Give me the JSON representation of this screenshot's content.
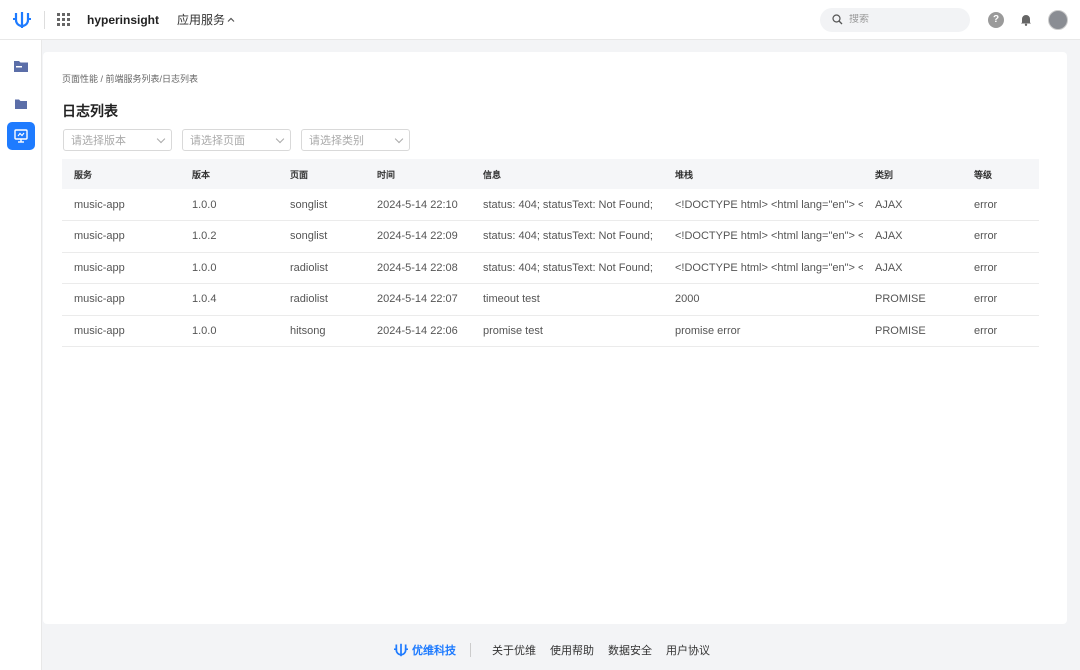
{
  "header": {
    "brand": "hyperinsight",
    "app_menu": "应用服务",
    "search_placeholder": "搜索",
    "help_symbol": "?"
  },
  "breadcrumb": "页面性能 / 前端服务列表/日志列表",
  "page_title": "日志列表",
  "filters": {
    "version": "请选择版本",
    "page": "请选择页面",
    "category": "请选择类别"
  },
  "table": {
    "columns": [
      "服务",
      "版本",
      "页面",
      "时间",
      "信息",
      "堆栈",
      "类别",
      "等级"
    ],
    "rows": [
      [
        "music-app",
        "1.0.0",
        "songlist",
        "2024-5-14 22:10",
        "status: 404; statusText: Not Found;",
        "<!DOCTYPE html> <html lang=\"en\"> <",
        "AJAX",
        "error"
      ],
      [
        "music-app",
        "1.0.2",
        "songlist",
        "2024-5-14 22:09",
        "status: 404; statusText: Not Found;",
        "<!DOCTYPE html> <html lang=\"en\"> <",
        "AJAX",
        "error"
      ],
      [
        "music-app",
        "1.0.0",
        "radiolist",
        "2024-5-14 22:08",
        "status: 404; statusText: Not Found;",
        "<!DOCTYPE html> <html lang=\"en\"> <",
        "AJAX",
        "error"
      ],
      [
        "music-app",
        "1.0.4",
        "radiolist",
        "2024-5-14 22:07",
        "timeout test",
        "2000",
        "PROMISE",
        "error"
      ],
      [
        "music-app",
        "1.0.0",
        "hitsong",
        "2024-5-14 22:06",
        "promise test",
        "promise error",
        "PROMISE",
        "error"
      ]
    ]
  },
  "footer": {
    "company": "优维科技",
    "links": [
      "关于优维",
      "使用帮助",
      "数据安全",
      "用户协议"
    ]
  },
  "colors": {
    "accent": "#1e7bff"
  }
}
